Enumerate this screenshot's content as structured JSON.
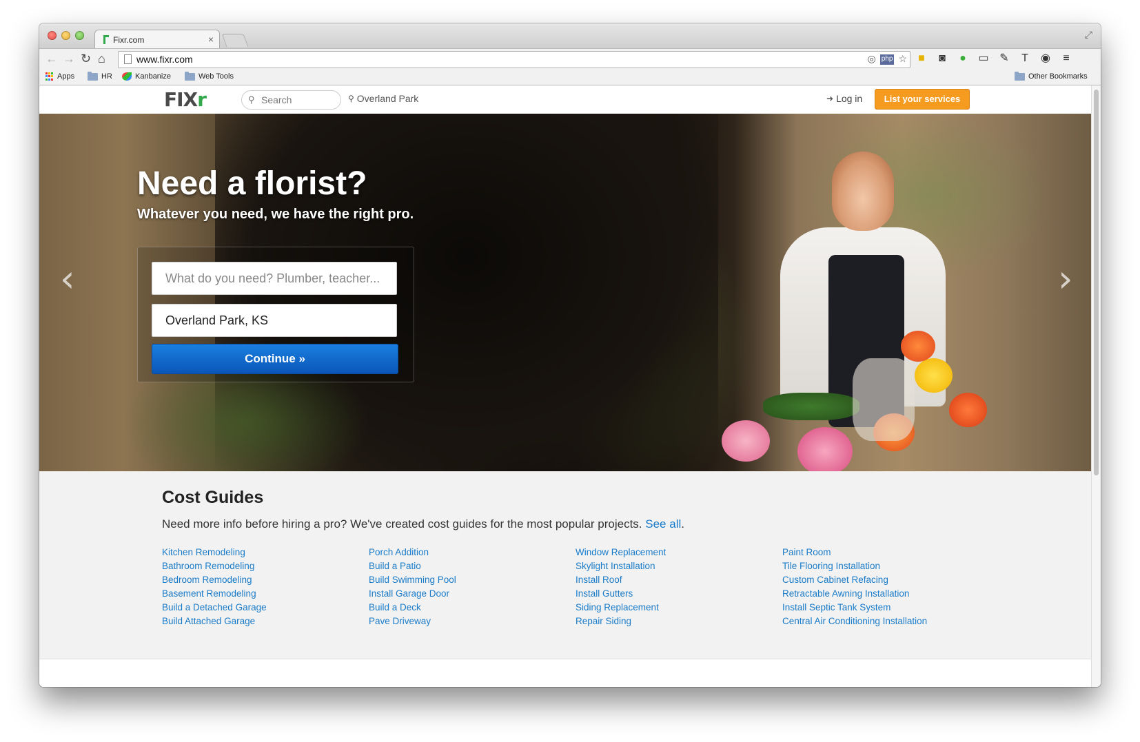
{
  "browser": {
    "tab_title": "Fixr.com",
    "tab_close": "×",
    "url": "www.fixr.com",
    "bookmarks": [
      "Apps",
      "HR",
      "Kanbanize",
      "Web Tools"
    ],
    "other_bookmarks": "Other Bookmarks"
  },
  "header": {
    "logo_main": "FIX",
    "logo_accent": "r",
    "search_placeholder": "Search",
    "location": "Overland Park",
    "login": "Log in",
    "list_services": "List your services"
  },
  "hero": {
    "headline": "Need a florist?",
    "subheadline": "Whatever you need, we have the right pro.",
    "need_placeholder": "What do you need? Plumber, teacher...",
    "location_value": "Overland Park, KS",
    "continue": "Continue »"
  },
  "cost_guides": {
    "title": "Cost Guides",
    "intro": "Need more info before hiring a pro? We've created cost guides for the most popular projects.",
    "see_all": "See all",
    "columns": [
      [
        "Kitchen Remodeling",
        "Bathroom Remodeling",
        "Bedroom Remodeling",
        "Basement Remodeling",
        "Build a Detached Garage",
        "Build Attached Garage"
      ],
      [
        "Porch Addition",
        "Build a Patio",
        "Build Swimming Pool",
        "Install Garage Door",
        "Build a Deck",
        "Pave Driveway"
      ],
      [
        "Window Replacement",
        "Skylight Installation",
        "Install Roof",
        "Install Gutters",
        "Siding Replacement",
        "Repair Siding"
      ],
      [
        "Paint Room",
        "Tile Flooring Installation",
        "Custom Cabinet Refacing",
        "Retractable Awning Installation",
        "Install Septic Tank System",
        "Central Air Conditioning Installation"
      ]
    ]
  },
  "colors": {
    "accent_orange": "#f59b20",
    "button_blue": "#0a56b8",
    "link_blue": "#1a7bc8",
    "brand_green": "#32a94c"
  }
}
